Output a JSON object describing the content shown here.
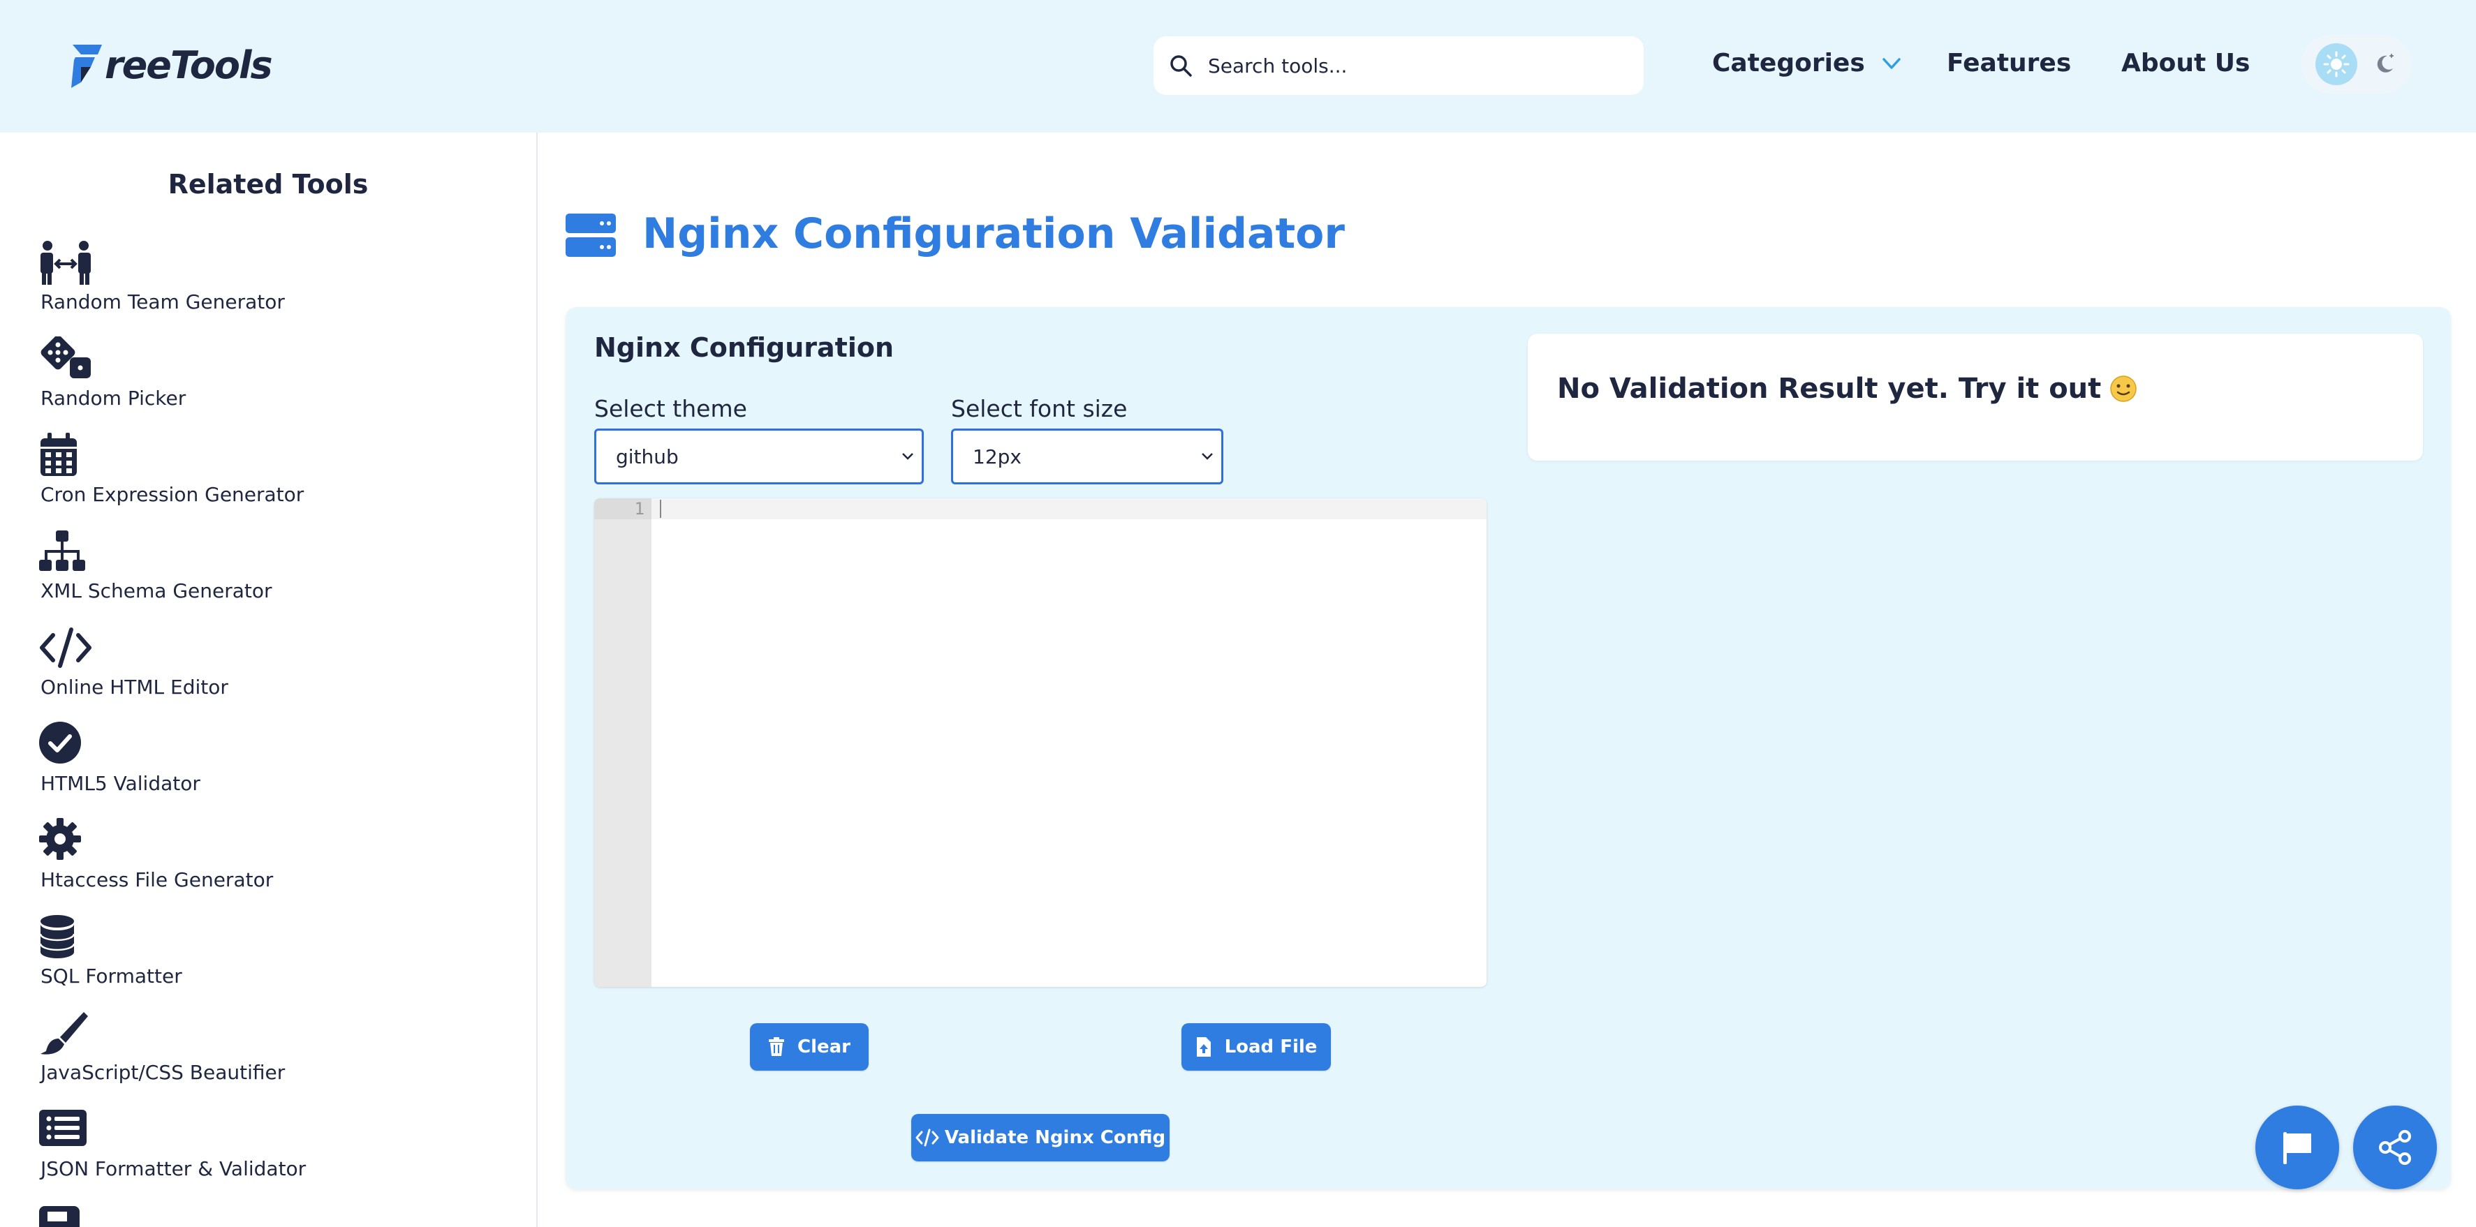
{
  "header": {
    "logo_text": "reeTools",
    "search_placeholder": "Search tools...",
    "nav": {
      "categories": "Categories",
      "features": "Features",
      "about": "About Us"
    },
    "icons": {
      "logo": "freetools-logo-icon",
      "search": "search-icon",
      "chevron": "chevron-down-icon",
      "sun": "sun-icon",
      "moon": "moon-icon"
    }
  },
  "sidebar": {
    "title": "Related Tools",
    "items": [
      {
        "label": "Random Team Generator",
        "icon": "people-arrows-icon"
      },
      {
        "label": "Random Picker",
        "icon": "dice-icon"
      },
      {
        "label": "Cron Expression Generator",
        "icon": "calendar-icon"
      },
      {
        "label": "XML Schema Generator",
        "icon": "sitemap-icon"
      },
      {
        "label": "Online HTML Editor",
        "icon": "code-icon"
      },
      {
        "label": "HTML5 Validator",
        "icon": "check-circle-icon"
      },
      {
        "label": "Htaccess File Generator",
        "icon": "gear-icon"
      },
      {
        "label": "SQL Formatter",
        "icon": "database-icon"
      },
      {
        "label": "JavaScript/CSS Beautifier",
        "icon": "brush-icon"
      },
      {
        "label": "JSON Formatter & Validator",
        "icon": "list-icon"
      }
    ]
  },
  "main": {
    "title": "Nginx Configuration Validator",
    "title_icon": "server-icon",
    "panel_title": "Nginx Configuration",
    "theme_label": "Select theme",
    "theme_value": "github",
    "font_label": "Select font size",
    "font_value": "12px",
    "editor": {
      "line_numbers": [
        "1"
      ],
      "content": ""
    },
    "buttons": {
      "clear": "Clear",
      "load": "Load File",
      "validate": "Validate Nginx Config"
    },
    "result_text": "No Validation Result yet. Try it out",
    "result_emoji": "slightly-smiling-face-icon"
  },
  "fabs": {
    "flag": "flag-icon",
    "share": "share-icon"
  },
  "colors": {
    "header_bg": "#e6f6fc",
    "accent": "#2f7de1",
    "text_dark": "#1e2640",
    "panel_bg": "#e5f6fc"
  }
}
